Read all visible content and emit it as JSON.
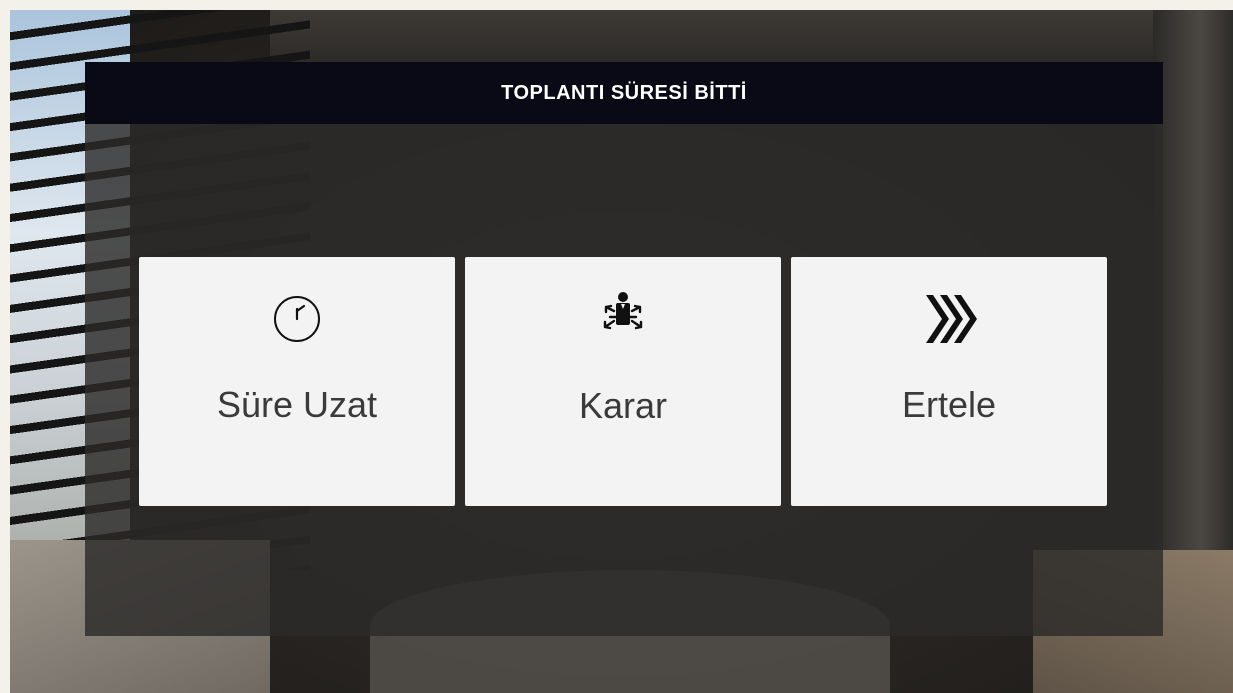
{
  "dialog": {
    "title": "TOPLANTI SÜRESİ BİTTİ",
    "options": [
      {
        "label": "Süre Uzat",
        "icon": "clock-icon"
      },
      {
        "label": "Karar",
        "icon": "decision-person-icon"
      },
      {
        "label": "Ertele",
        "icon": "triple-chevron-right-icon"
      }
    ]
  },
  "colors": {
    "header_bg": "#0a0a17",
    "card_bg": "#f3f3f3",
    "card_text": "#3a3a3a"
  }
}
